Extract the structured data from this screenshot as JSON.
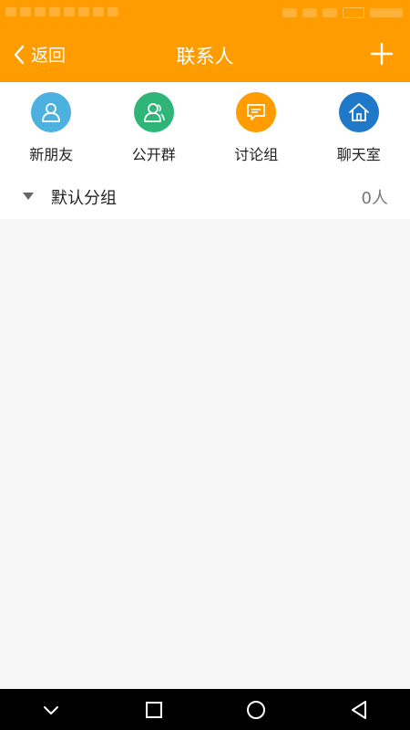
{
  "theme": {
    "header_color": "#ff9c00",
    "new_friend_color": "#4db1e0",
    "public_group_color": "#2fb578",
    "discussion_color": "#ff9c00",
    "chatroom_color": "#1f78c8"
  },
  "header": {
    "back_label": "返回",
    "title": "联系人",
    "add_icon": "plus-icon"
  },
  "quick_entries": [
    {
      "label": "新朋友",
      "icon": "person-icon"
    },
    {
      "label": "公开群",
      "icon": "group-icon"
    },
    {
      "label": "讨论组",
      "icon": "chat-bubble-icon"
    },
    {
      "label": "聊天室",
      "icon": "home-icon"
    }
  ],
  "groups": [
    {
      "name": "默认分组",
      "count": "0人",
      "expanded": true
    }
  ],
  "system_nav": {
    "buttons": [
      "collapse-chevron-icon",
      "recent-apps-icon",
      "home-circle-icon",
      "back-triangle-icon"
    ]
  }
}
